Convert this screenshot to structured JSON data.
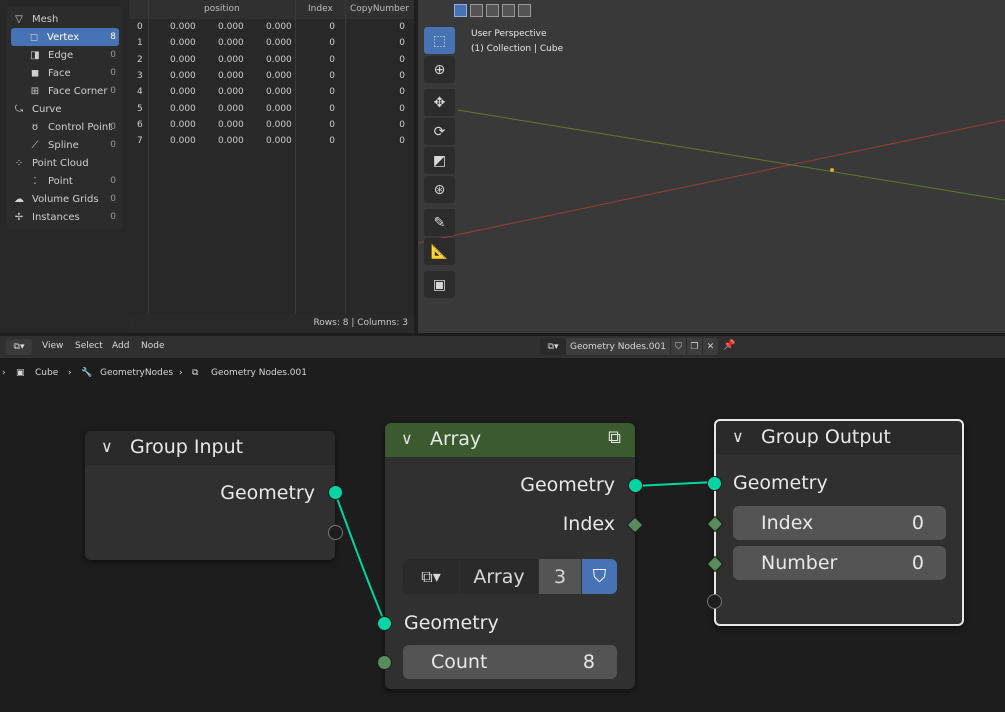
{
  "spreadsheet": {
    "domains": [
      {
        "label": "Mesh",
        "count": "",
        "icon": "mesh-icon",
        "indent": 0,
        "selected": false
      },
      {
        "label": "Vertex",
        "count": "8",
        "icon": "vertex-icon",
        "indent": 1,
        "selected": true
      },
      {
        "label": "Edge",
        "count": "0",
        "icon": "edge-icon",
        "indent": 1,
        "selected": false
      },
      {
        "label": "Face",
        "count": "0",
        "icon": "face-icon",
        "indent": 1,
        "selected": false
      },
      {
        "label": "Face Corner",
        "count": "0",
        "icon": "face-corner-icon",
        "indent": 1,
        "selected": false
      },
      {
        "label": "Curve",
        "count": "",
        "icon": "curve-icon",
        "indent": 0,
        "selected": false
      },
      {
        "label": "Control Point",
        "count": "0",
        "icon": "control-point-icon",
        "indent": 1,
        "selected": false
      },
      {
        "label": "Spline",
        "count": "0",
        "icon": "spline-icon",
        "indent": 1,
        "selected": false
      },
      {
        "label": "Point Cloud",
        "count": "",
        "icon": "point-cloud-icon",
        "indent": 0,
        "selected": false
      },
      {
        "label": "Point",
        "count": "0",
        "icon": "point-icon",
        "indent": 1,
        "selected": false
      },
      {
        "label": "Volume Grids",
        "count": "0",
        "icon": "volume-grids-icon",
        "indent": 0,
        "selected": false
      },
      {
        "label": "Instances",
        "count": "0",
        "icon": "instances-icon",
        "indent": 0,
        "selected": false
      }
    ],
    "columns": [
      "position",
      "Index",
      "CopyNumber"
    ],
    "rows": [
      {
        "idx": "0",
        "x": "0.000",
        "y": "0.000",
        "z": "0.000",
        "index": "0",
        "copy": "0"
      },
      {
        "idx": "1",
        "x": "0.000",
        "y": "0.000",
        "z": "0.000",
        "index": "0",
        "copy": "0"
      },
      {
        "idx": "2",
        "x": "0.000",
        "y": "0.000",
        "z": "0.000",
        "index": "0",
        "copy": "0"
      },
      {
        "idx": "3",
        "x": "0.000",
        "y": "0.000",
        "z": "0.000",
        "index": "0",
        "copy": "0"
      },
      {
        "idx": "4",
        "x": "0.000",
        "y": "0.000",
        "z": "0.000",
        "index": "0",
        "copy": "0"
      },
      {
        "idx": "5",
        "x": "0.000",
        "y": "0.000",
        "z": "0.000",
        "index": "0",
        "copy": "0"
      },
      {
        "idx": "6",
        "x": "0.000",
        "y": "0.000",
        "z": "0.000",
        "index": "0",
        "copy": "0"
      },
      {
        "idx": "7",
        "x": "0.000",
        "y": "0.000",
        "z": "0.000",
        "index": "0",
        "copy": "0"
      }
    ],
    "footer": "Rows: 8   |   Columns: 3"
  },
  "viewport": {
    "line1": "User Perspective",
    "line2": "(1) Collection | Cube",
    "tools": [
      "select-box-icon",
      "cursor-icon",
      "move-icon",
      "rotate-icon",
      "scale-icon",
      "transform-icon",
      "annotate-icon",
      "measure-icon",
      "add-cube-icon"
    ],
    "axis_x_color": "#9a3a3a",
    "axis_y_color": "#5f7a2a"
  },
  "node_editor": {
    "menus": [
      "View",
      "Select",
      "Add",
      "Node"
    ],
    "tree_name": "Geometry Nodes.001",
    "breadcrumb": [
      "Cube",
      "GeometryNodes",
      "Geometry Nodes.001"
    ],
    "group_input": {
      "title": "Group Input",
      "outputs": [
        "Geometry"
      ]
    },
    "array": {
      "title": "Array",
      "outputs": [
        "Geometry",
        "Index"
      ],
      "group_name": "Array",
      "users": "3",
      "inputs": [
        "Geometry"
      ],
      "count_label": "Count",
      "count_value": "8",
      "header_color": "#3b5a2e"
    },
    "group_output": {
      "title": "Group Output",
      "inputs": [
        "Geometry"
      ],
      "index_label": "Index",
      "index_value": "0",
      "number_label": "Number",
      "number_value": "0"
    },
    "colors": {
      "geometry_socket": "#00d6a3",
      "int_socket": "#598c5c",
      "selection": "#4772b3"
    }
  }
}
